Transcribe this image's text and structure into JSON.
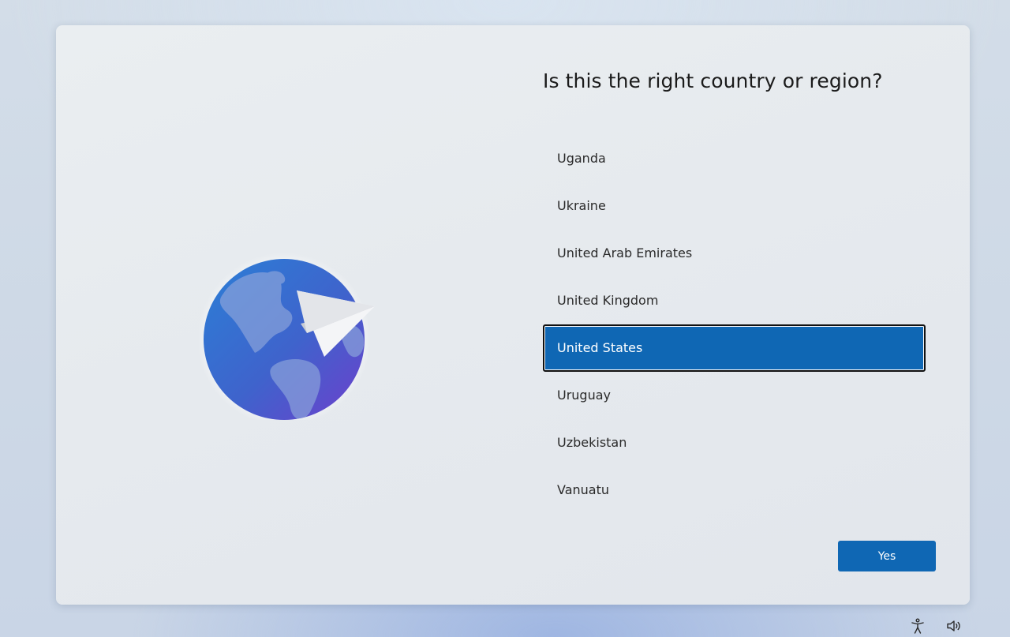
{
  "setup": {
    "heading": "Is this the right country or region?",
    "countries": [
      {
        "label": "Uganda"
      },
      {
        "label": "Ukraine"
      },
      {
        "label": "United Arab Emirates"
      },
      {
        "label": "United Kingdom"
      },
      {
        "label": "United States"
      },
      {
        "label": "Uruguay"
      },
      {
        "label": "Uzbekistan"
      },
      {
        "label": "Vanuatu"
      }
    ],
    "selected": "United States",
    "yes_label": "Yes"
  },
  "illustration": {
    "icon": "globe-with-paper-plane-icon"
  },
  "taskbar": {
    "icons": [
      "accessibility-icon",
      "volume-icon"
    ]
  },
  "colors": {
    "accent": "#0f67b4",
    "selected_border": "#101010",
    "card_background": "#e7ebef",
    "text": "#1b1b1b"
  }
}
